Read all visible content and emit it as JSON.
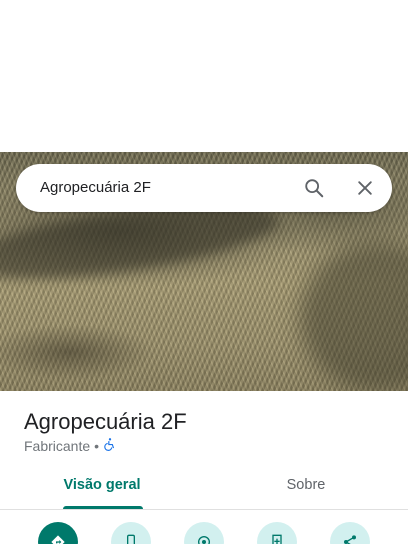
{
  "search": {
    "query": "Agropecuária 2F"
  },
  "place": {
    "name": "Agropecuária 2F",
    "category": "Fabricante",
    "separator": "•"
  },
  "tabs": [
    {
      "label": "Visão geral",
      "active": true
    },
    {
      "label": "Sobre",
      "active": false
    }
  ],
  "actions": [
    {
      "icon": "directions-icon"
    },
    {
      "icon": "phone-icon"
    },
    {
      "icon": "location-icon"
    },
    {
      "icon": "save-icon"
    },
    {
      "icon": "share-icon"
    }
  ],
  "colors": {
    "accent": "#00796b",
    "action_bg": "#d2f0ef",
    "accessibility": "#1a73e8"
  }
}
